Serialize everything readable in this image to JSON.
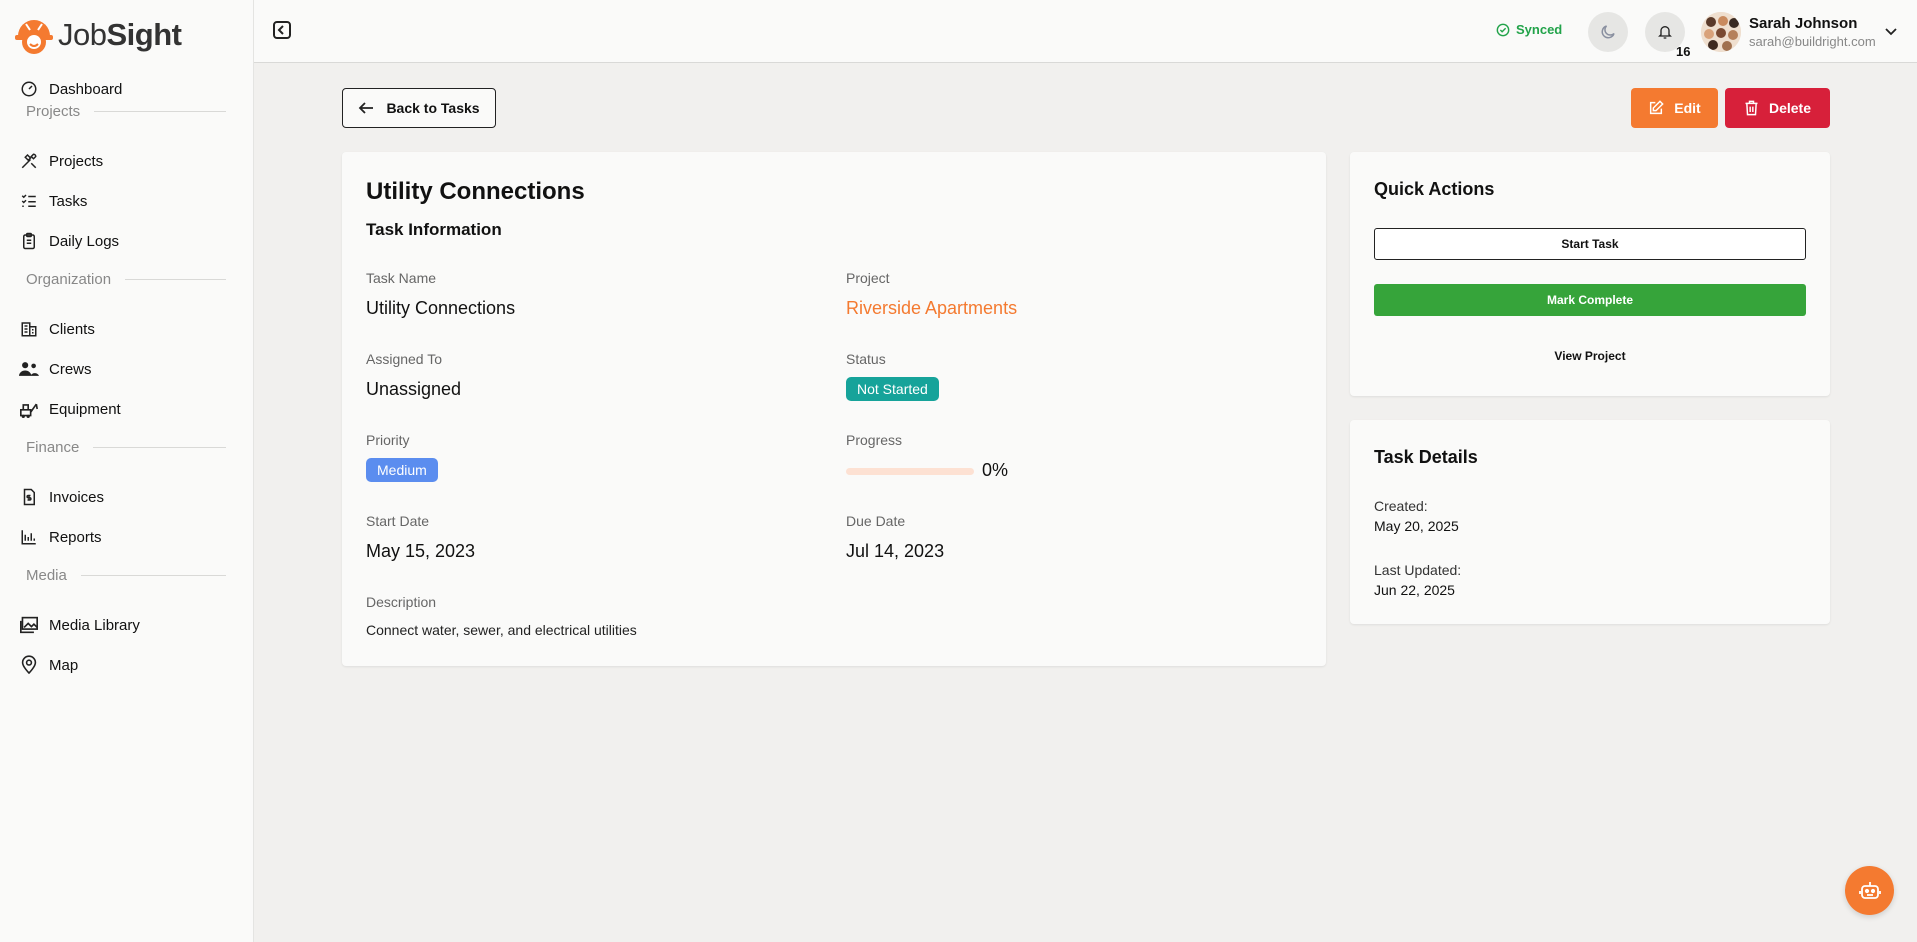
{
  "brand": {
    "name_part1": "Job",
    "name_part2": "Sight",
    "accent": "#f47a30"
  },
  "sidebar": {
    "items": [
      {
        "label": "Dashboard",
        "icon": "dashboard-gauge-icon"
      },
      {
        "section": "Projects"
      },
      {
        "label": "Projects",
        "icon": "tools-icon"
      },
      {
        "label": "Tasks",
        "icon": "list-checks-icon"
      },
      {
        "label": "Daily Logs",
        "icon": "clipboard-icon"
      },
      {
        "section": "Organization"
      },
      {
        "label": "Clients",
        "icon": "building-icon"
      },
      {
        "label": "Crews",
        "icon": "users-icon"
      },
      {
        "label": "Equipment",
        "icon": "equipment-icon"
      },
      {
        "section": "Finance"
      },
      {
        "label": "Invoices",
        "icon": "invoice-icon"
      },
      {
        "label": "Reports",
        "icon": "bar-chart-icon"
      },
      {
        "section": "Media"
      },
      {
        "label": "Media Library",
        "icon": "image-icon"
      },
      {
        "label": "Map",
        "icon": "map-pin-icon"
      }
    ]
  },
  "header": {
    "sync_status": "Synced",
    "notification_count": "16",
    "user_name": "Sarah Johnson",
    "user_email": "sarah@buildright.com"
  },
  "actions": {
    "back_label": "Back to Tasks",
    "edit_label": "Edit",
    "delete_label": "Delete"
  },
  "task": {
    "title": "Utility Connections",
    "section_title": "Task Information",
    "task_name_label": "Task Name",
    "task_name": "Utility Connections",
    "project_label": "Project",
    "project": "Riverside Apartments",
    "assigned_label": "Assigned To",
    "assigned": "Unassigned",
    "status_label": "Status",
    "status": "Not Started",
    "status_color": "#16a39a",
    "priority_label": "Priority",
    "priority": "Medium",
    "priority_color": "#5b8def",
    "progress_label": "Progress",
    "progress_text": "0%",
    "progress_fraction": 0,
    "start_label": "Start Date",
    "start_date": "May 15, 2023",
    "due_label": "Due Date",
    "due_date": "Jul 14, 2023",
    "description_label": "Description",
    "description": "Connect water, sewer, and electrical utilities"
  },
  "quick_actions": {
    "title": "Quick Actions",
    "start_label": "Start Task",
    "complete_label": "Mark Complete",
    "view_label": "View Project"
  },
  "task_details": {
    "title": "Task Details",
    "created_label": "Created:",
    "created": "May 20, 2025",
    "updated_label": "Last Updated:",
    "updated": "Jun 22, 2025"
  }
}
